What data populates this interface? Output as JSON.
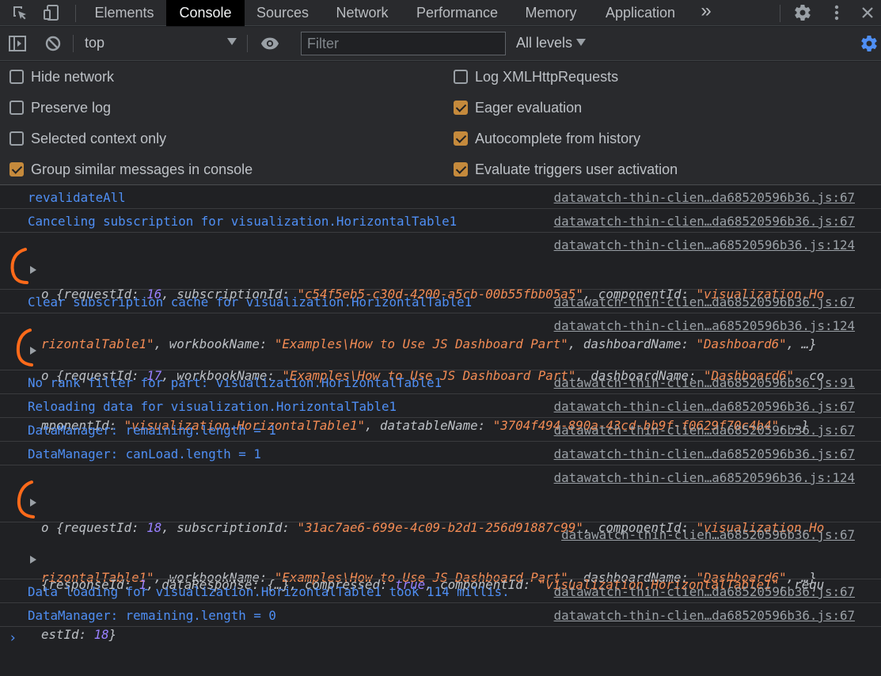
{
  "tabs": {
    "items": [
      "Elements",
      "Console",
      "Sources",
      "Network",
      "Performance",
      "Memory",
      "Application"
    ],
    "overflow": "»",
    "active": "Console"
  },
  "toolbar": {
    "context": "top",
    "filter_placeholder": "Filter",
    "levels": "All levels"
  },
  "settings": {
    "left": [
      {
        "label": "Hide network",
        "checked": false
      },
      {
        "label": "Preserve log",
        "checked": false
      },
      {
        "label": "Selected context only",
        "checked": false
      },
      {
        "label": "Group similar messages in console",
        "checked": true
      }
    ],
    "right": [
      {
        "label": "Log XMLHttpRequests",
        "checked": false
      },
      {
        "label": "Eager evaluation",
        "checked": true
      },
      {
        "label": "Autocomplete from history",
        "checked": true
      },
      {
        "label": "Evaluate triggers user activation",
        "checked": true
      }
    ]
  },
  "log": {
    "rows": [
      {
        "text": "revalidateAll",
        "source": "datawatch-thin-clien…da68520596b36.js:67"
      },
      {
        "text": "Canceling subscription for visualization.HorizontalTable1",
        "source": "datawatch-thin-clien…da68520596b36.js:67"
      },
      {
        "source": "datawatch-thin-clien…a68520596b36.js:124",
        "obj1_line1": [
          "o {",
          "requestId",
          ": ",
          "16",
          ", ",
          "subscriptionId",
          ": ",
          "\"c54f5eb5-c30d-4200-a5cb-00b55fbb05a5\"",
          ", ",
          "componentId",
          ": ",
          "\"visualization.Ho"
        ],
        "obj1_line2": [
          "rizontalTable1\"",
          ", ",
          "workbookName",
          ": ",
          "\"Examples\\How to Use JS Dashboard Part\"",
          ", ",
          "dashboardName",
          ": ",
          "\"Dashboard6\"",
          ", …}"
        ]
      },
      {
        "text": "Clear subscription cache for visualization.HorizontalTable1",
        "source": "datawatch-thin-clien…da68520596b36.js:67"
      },
      {
        "source": "datawatch-thin-clien…a68520596b36.js:124",
        "obj2_line1": [
          "o {",
          "requestId",
          ": ",
          "17",
          ", ",
          "workbookName",
          ": ",
          "\"Examples\\How to Use JS Dashboard Part\"",
          ", ",
          "dashboardName",
          ": ",
          "\"Dashboard6\"",
          ", co"
        ],
        "obj2_line2": [
          "mponentId",
          ": ",
          "\"visualization.HorizontalTable1\"",
          ", ",
          "datatableName",
          ": ",
          "\"3704f494-890a-43cd-bb9f-f0629f70c4b4\"",
          ", …}"
        ]
      },
      {
        "text": "No rank filter for part: visualization.HorizontalTable1",
        "source": "datawatch-thin-clien…da68520596b36.js:91"
      },
      {
        "text": "Reloading data for visualization.HorizontalTable1",
        "source": "datawatch-thin-clien…da68520596b36.js:67"
      },
      {
        "text": "DataManager: remaining.length = 1",
        "source": "datawatch-thin-clien…da68520596b36.js:67"
      },
      {
        "text": "DataManager: canLoad.length = 1",
        "source": "datawatch-thin-clien…da68520596b36.js:67"
      },
      {
        "source": "datawatch-thin-clien…a68520596b36.js:124",
        "obj3_line1": [
          "o {",
          "requestId",
          ": ",
          "18",
          ", ",
          "subscriptionId",
          ": ",
          "\"31ac7ae6-699e-4c09-b2d1-256d91887c99\"",
          ", ",
          "componentId",
          ": ",
          "\"visualization.Ho"
        ],
        "obj3_line2": [
          "rizontalTable1\"",
          ", ",
          "workbookName",
          ": ",
          "\"Examples\\How to Use JS Dashboard Part\"",
          ", ",
          "dashboardName",
          ": ",
          "\"Dashboard6\"",
          ", …}"
        ]
      },
      {
        "source": "datawatch-thin-clien…a68520596b36.js:67",
        "obj4_line1": [
          "{",
          "responseId",
          ": ",
          "1",
          ", ",
          "dataResponse",
          ": ",
          "{…}",
          ", ",
          "compressed",
          ": ",
          "true",
          ", ",
          "componentId",
          ": ",
          "\"visualization.HorizontalTable1\"",
          ", ",
          "requ"
        ],
        "obj4_line2": [
          "estId",
          ": ",
          "18",
          "}"
        ]
      },
      {
        "text": "Data loading for visualization.HorizontalTable1 took 114 millis.",
        "source": "datawatch-thin-clien…da68520596b36.js:67"
      },
      {
        "text": "DataManager: remaining.length = 0",
        "source": "datawatch-thin-clien…da68520596b36.js:67"
      }
    ],
    "prompt": "›"
  },
  "colors": {
    "annotation": "#ff6a1a",
    "string": "#f28b54",
    "number": "#9980ff",
    "log_text": "#4f8ff5",
    "checkbox_on": "#c58a3c"
  },
  "icons": [
    "inspect-element-icon",
    "device-toolbar-icon",
    "sidebar-toggle-icon",
    "clear-console-icon",
    "eye-icon",
    "gear-icon",
    "kebab-menu-icon",
    "close-icon"
  ]
}
